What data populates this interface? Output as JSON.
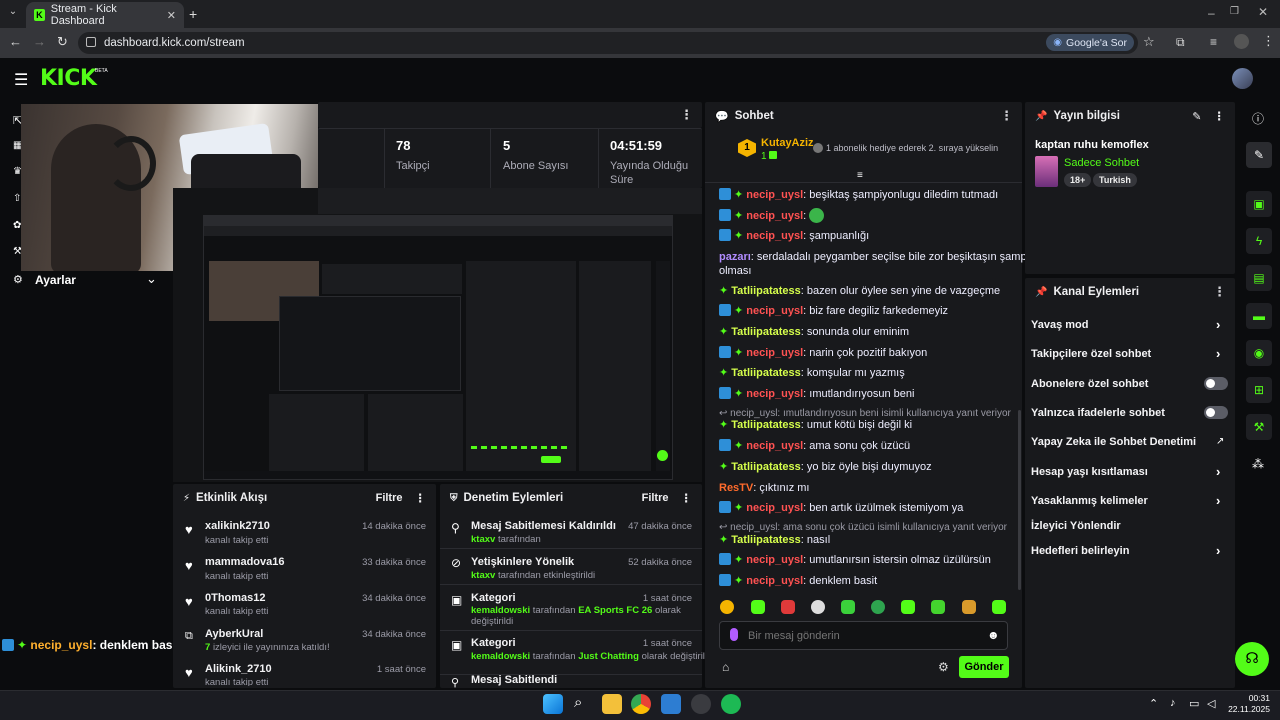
{
  "browser": {
    "tab_title": "Stream - Kick Dashboard",
    "url": "dashboard.kick.com/stream",
    "google_btn": "Google'a Sor"
  },
  "brand": {
    "logo": "KICK",
    "beta": "BETA"
  },
  "sidebar": {
    "settings_label": "Ayarlar"
  },
  "overlay_chat": {
    "user": "necip_uysl",
    "message": ": denklem basit"
  },
  "stats": [
    {
      "value": "78",
      "label": "Takipçi"
    },
    {
      "value": "5",
      "label": "Abone Sayısı"
    },
    {
      "value": "04:51:59",
      "label": "Yayında Olduğu Süre"
    }
  ],
  "activity": {
    "title": "Etkinlik Akışı",
    "filter": "Filtre",
    "items": [
      {
        "name": "xalikink2710",
        "sub": "kanalı takip etti",
        "time": "14 dakika önce"
      },
      {
        "name": "mammadova16",
        "sub": "kanalı takip etti",
        "time": "33 dakika önce"
      },
      {
        "name": "0Thomas12",
        "sub": "kanalı takip etti",
        "time": "34 dakika önce"
      },
      {
        "name": "AyberkUral",
        "sub_count": "7",
        "sub": "izleyici ile yayınınıza katıldı!",
        "time": "34 dakika önce"
      },
      {
        "name": "Alikink_2710",
        "sub": "kanalı takip etti",
        "time": "1 saat önce"
      }
    ]
  },
  "moderation": {
    "title": "Denetim Eylemleri",
    "filter": "Filtre",
    "items": [
      {
        "title": "Mesaj Sabitlemesi Kaldırıldı",
        "by": "ktaxv",
        "rest": "tarafından",
        "extra": "",
        "tail": "",
        "time": "47 dakika önce"
      },
      {
        "title": "Yetişkinlere Yönelik",
        "by": "ktaxv",
        "rest": "tarafından etkinleştirildi",
        "extra": "",
        "tail": "",
        "time": "52 dakika önce"
      },
      {
        "title": "Kategori",
        "by": "kemaldowski",
        "rest": "tarafından",
        "extra": "EA Sports FC 26",
        "tail": "olarak değiştirildi",
        "time": "1 saat önce"
      },
      {
        "title": "Kategori",
        "by": "kemaldowski",
        "rest": "tarafından",
        "extra": "Just Chatting",
        "tail": "olarak değiştirildi",
        "time": "1 saat önce"
      },
      {
        "title": "Mesaj Sabitlendi",
        "by": "",
        "rest": "",
        "extra": "",
        "tail": "",
        "time": ""
      }
    ]
  },
  "chat": {
    "title": "Sohbet",
    "top_user": "KutayAziz",
    "top_rank": "1",
    "top_count": "1",
    "top_msg": "1 abonelik hediye ederek 2. sıraya yükselin",
    "lines": [
      {
        "user": "necip_uysl",
        "msg": "beşiktaş şampiyonlugu diledim tutmadı"
      },
      {
        "user": "necip_uysl",
        "msg": ""
      },
      {
        "user": "necip_uysl",
        "msg": "şampuanlığı"
      },
      {
        "user": "pazarı",
        "msg": "serdaladalı peygamber seçilse bile zor beşiktaşın şampiyon"
      },
      {
        "user": "",
        "msg": "olması"
      },
      {
        "user": "Tatliipatatess",
        "msg": "bazen olur öylee sen yine de vazgeçme"
      },
      {
        "user": "necip_uysl",
        "msg": "biz fare degiliz farkedemeyiz"
      },
      {
        "user": "Tatliipatatess",
        "msg": "sonunda olur eminim"
      },
      {
        "user": "necip_uysl",
        "msg": "narin çok pozitif bakıyon"
      },
      {
        "user": "Tatliipatatess",
        "msg": "komşular mı yazmış"
      },
      {
        "user": "necip_uysl",
        "msg": "ımutlandırıyosun beni"
      },
      {
        "user": "Tatliipatatess",
        "msg": "umut kötü bişi değil ki"
      },
      {
        "user": "necip_uysl",
        "msg": "ama sonu çok üzücü"
      },
      {
        "user": "Tatliipatatess",
        "msg": "yo biz öyle bişi duymuyoz"
      },
      {
        "user": "ResTV",
        "msg": "çıktınız mı"
      },
      {
        "user": "necip_uysl",
        "msg": "ben artık üzülmek istemiyom ya"
      },
      {
        "user": "Tatliipatatess",
        "msg": "nasıl"
      },
      {
        "user": "necip_uysl",
        "msg": "umutlanırsın istersin olmaz üzülürsün"
      },
      {
        "user": "necip_uysl",
        "msg": "denklem basit"
      }
    ],
    "replies": [
      "necip_uysl: ımutlandırıyosun beni isimli kullanıcıya yanıt veriyor",
      "necip_uysl: ama sonu çok üzücü isimli kullanıcıya yanıt veriyor"
    ],
    "placeholder": "Bir mesaj gönderin",
    "send": "Gönder"
  },
  "stream_info": {
    "title": "Yayın bilgisi",
    "stream_title": "kaptan ruhu kemoflex",
    "category": "Sadece Sohbet",
    "tags": [
      "18+",
      "Turkish"
    ]
  },
  "channel_actions": {
    "title": "Kanal Eylemleri",
    "items": [
      {
        "label": "Yavaş mod",
        "control": "chevron"
      },
      {
        "label": "Takipçilere özel sohbet",
        "control": "chevron"
      },
      {
        "label": "Abonelere özel sohbet",
        "control": "toggle"
      },
      {
        "label": "Yalnızca ifadelerle sohbet",
        "control": "toggle"
      },
      {
        "label": "Yapay Zeka ile Sohbet Denetimi",
        "control": "external"
      },
      {
        "label": "Hesap yaşı kısıtlaması",
        "control": "chevron"
      },
      {
        "label": "Yasaklanmış kelimeler",
        "control": "chevron"
      },
      {
        "label": "İzleyici Yönlendir",
        "control": "none"
      },
      {
        "label": "Hedefleri belirleyin",
        "control": "chevron"
      }
    ]
  },
  "taskbar": {
    "time": "00:31",
    "date": "22.11.2025"
  },
  "colors": {
    "accent": "#53fc18",
    "panel": "#18191c",
    "bg": "#0b0c0e"
  }
}
